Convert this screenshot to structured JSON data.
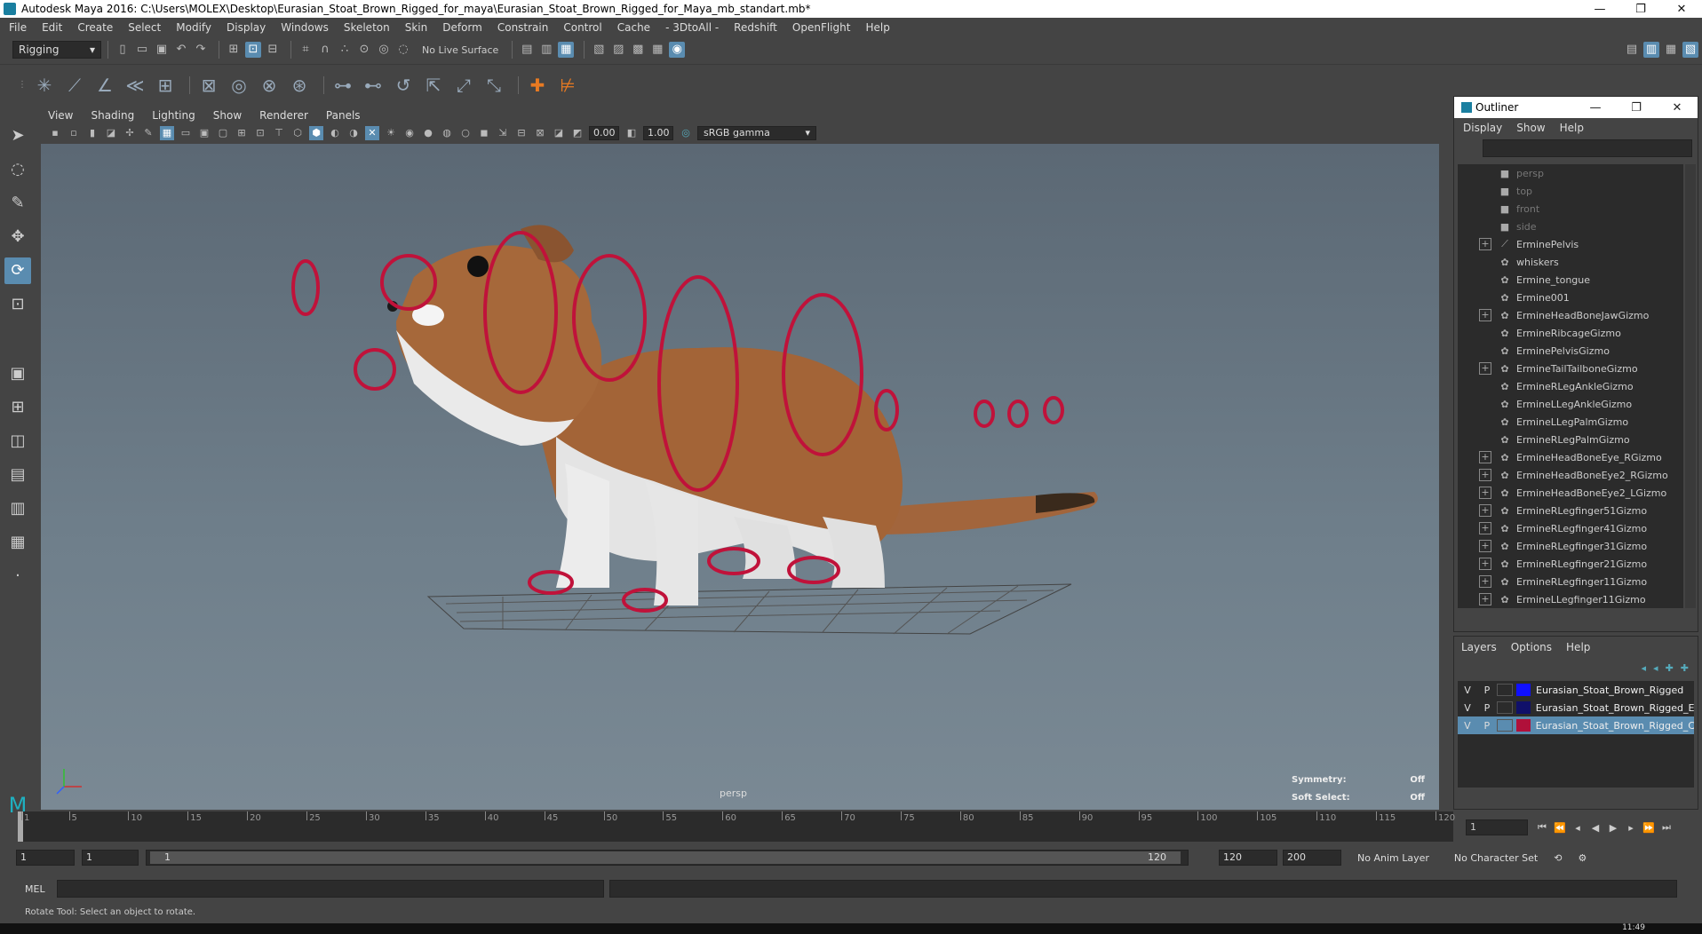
{
  "window": {
    "title": "Autodesk Maya 2016: C:\\Users\\MOLEX\\Desktop\\Eurasian_Stoat_Brown_Rigged_for_maya\\Eurasian_Stoat_Brown_Rigged_for_Maya_mb_standart.mb*",
    "controls": {
      "minimize": "—",
      "maximize": "❐",
      "close": "✕"
    }
  },
  "menubar": [
    "File",
    "Edit",
    "Create",
    "Select",
    "Modify",
    "Display",
    "Windows",
    "Skeleton",
    "Skin",
    "Deform",
    "Constrain",
    "Control",
    "Cache",
    "- 3DtoAll -",
    "Redshift",
    "OpenFlight",
    "Help"
  ],
  "statusline": {
    "menuset": "Rigging",
    "live_surface": "No Live Surface"
  },
  "viewport": {
    "menu": [
      "View",
      "Shading",
      "Lighting",
      "Show",
      "Renderer",
      "Panels"
    ],
    "exposure": "0.00",
    "gamma": "1.00",
    "colorspace": "sRGB gamma",
    "camera": "persp",
    "symmetry_label": "Symmetry:",
    "symmetry_value": "Off",
    "softselect_label": "Soft Select:",
    "softselect_value": "Off"
  },
  "outliner": {
    "title": "Outliner",
    "menu": [
      "Display",
      "Show",
      "Help"
    ],
    "items": [
      {
        "label": "persp",
        "expandable": false,
        "dim": true,
        "icon": "camera-icon"
      },
      {
        "label": "top",
        "expandable": false,
        "dim": true,
        "icon": "camera-icon"
      },
      {
        "label": "front",
        "expandable": false,
        "dim": true,
        "icon": "camera-icon"
      },
      {
        "label": "side",
        "expandable": false,
        "dim": true,
        "icon": "camera-icon"
      },
      {
        "label": "ErminePelvis",
        "expandable": true,
        "dim": false,
        "icon": "joint-icon"
      },
      {
        "label": "whiskers",
        "expandable": false,
        "dim": false,
        "icon": "transform-icon"
      },
      {
        "label": "Ermine_tongue",
        "expandable": false,
        "dim": false,
        "icon": "transform-icon"
      },
      {
        "label": "Ermine001",
        "expandable": false,
        "dim": false,
        "icon": "transform-icon"
      },
      {
        "label": "ErmineHeadBoneJawGizmo",
        "expandable": true,
        "dim": false,
        "icon": "transform-icon"
      },
      {
        "label": "ErmineRibcageGizmo",
        "expandable": false,
        "dim": false,
        "icon": "transform-icon"
      },
      {
        "label": "ErminePelvisGizmo",
        "expandable": false,
        "dim": false,
        "icon": "transform-icon"
      },
      {
        "label": "ErmineTailTailboneGizmo",
        "expandable": true,
        "dim": false,
        "icon": "transform-icon"
      },
      {
        "label": "ErmineRLegAnkleGizmo",
        "expandable": false,
        "dim": false,
        "icon": "transform-icon"
      },
      {
        "label": "ErmineLLegAnkleGizmo",
        "expandable": false,
        "dim": false,
        "icon": "transform-icon"
      },
      {
        "label": "ErmineLLegPalmGizmo",
        "expandable": false,
        "dim": false,
        "icon": "transform-icon"
      },
      {
        "label": "ErmineRLegPalmGizmo",
        "expandable": false,
        "dim": false,
        "icon": "transform-icon"
      },
      {
        "label": "ErmineHeadBoneEye_RGizmo",
        "expandable": true,
        "dim": false,
        "icon": "transform-icon"
      },
      {
        "label": "ErmineHeadBoneEye2_RGizmo",
        "expandable": true,
        "dim": false,
        "icon": "transform-icon"
      },
      {
        "label": "ErmineHeadBoneEye2_LGizmo",
        "expandable": true,
        "dim": false,
        "icon": "transform-icon"
      },
      {
        "label": "ErmineRLegfinger51Gizmo",
        "expandable": true,
        "dim": false,
        "icon": "transform-icon"
      },
      {
        "label": "ErmineRLegfinger41Gizmo",
        "expandable": true,
        "dim": false,
        "icon": "transform-icon"
      },
      {
        "label": "ErmineRLegfinger31Gizmo",
        "expandable": true,
        "dim": false,
        "icon": "transform-icon"
      },
      {
        "label": "ErmineRLegfinger21Gizmo",
        "expandable": true,
        "dim": false,
        "icon": "transform-icon"
      },
      {
        "label": "ErmineRLegfinger11Gizmo",
        "expandable": true,
        "dim": false,
        "icon": "transform-icon"
      },
      {
        "label": "ErmineLLegfinger11Gizmo",
        "expandable": true,
        "dim": false,
        "icon": "transform-icon"
      }
    ]
  },
  "layers": {
    "menu": [
      "Layers",
      "Options",
      "Help"
    ],
    "rows": [
      {
        "v": "V",
        "p": "P",
        "color": "#1010ff",
        "name": "Eurasian_Stoat_Brown_Rigged",
        "selected": false
      },
      {
        "v": "V",
        "p": "P",
        "color": "#10106a",
        "name": "Eurasian_Stoat_Brown_Rigged_E",
        "selected": false
      },
      {
        "v": "V",
        "p": "P",
        "color": "#b0103a",
        "name": "Eurasian_Stoat_Brown_Rigged_C",
        "selected": true
      }
    ]
  },
  "timeslider": {
    "ticks": [
      "1",
      "5",
      "10",
      "15",
      "20",
      "25",
      "30",
      "35",
      "40",
      "45",
      "50",
      "55",
      "60",
      "65",
      "70",
      "75",
      "80",
      "85",
      "90",
      "95",
      "100",
      "105",
      "110",
      "115",
      "120"
    ],
    "current_frame": "1"
  },
  "range": {
    "start": "1",
    "playback_start": "1",
    "range_start": "1",
    "range_end": "120",
    "playback_end": "120",
    "end": "200",
    "anim_layer": "No Anim Layer",
    "char_set": "No Character Set"
  },
  "cmdline": {
    "label": "MEL"
  },
  "helpline": "Rotate Tool: Select an object to rotate.",
  "taskbar": {
    "clock": "11:49"
  }
}
